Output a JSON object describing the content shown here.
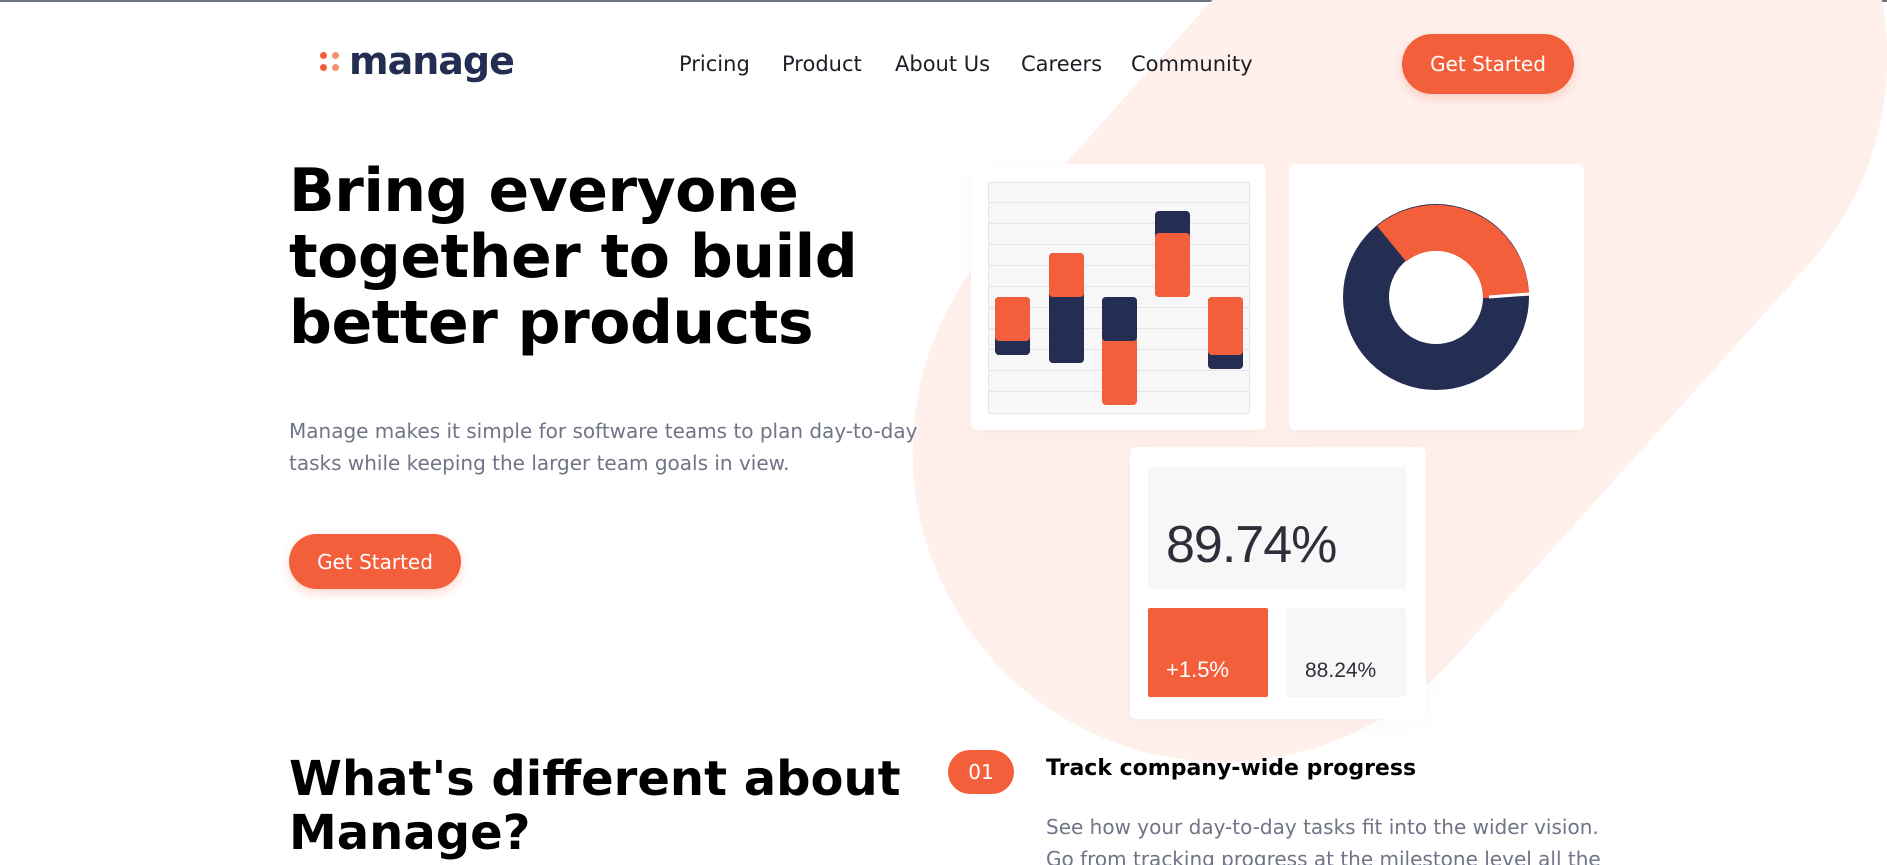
{
  "brand": {
    "name": "manage",
    "accent": "#f25f3a",
    "navy": "#242d52"
  },
  "nav": {
    "items": [
      "Pricing",
      "Product",
      "About Us",
      "Careers",
      "Community"
    ]
  },
  "header": {
    "cta_label": "Get Started"
  },
  "hero": {
    "title": "Bring everyone together to build better products",
    "text": "Manage makes it simple for software teams to plan day-to-day tasks while keeping the larger team goals in view.",
    "cta_label": "Get Started"
  },
  "stats": {
    "main_value": "89.74%",
    "change_value": "+1.5%",
    "secondary_value": "88.24%"
  },
  "section": {
    "title": "What's different about Manage?"
  },
  "features": [
    {
      "number": "01",
      "title": "Track company-wide progress",
      "text": "See how your day-to-day tasks fit into the wider vision. Go from tracking progress at the milestone level all the way"
    }
  ]
}
